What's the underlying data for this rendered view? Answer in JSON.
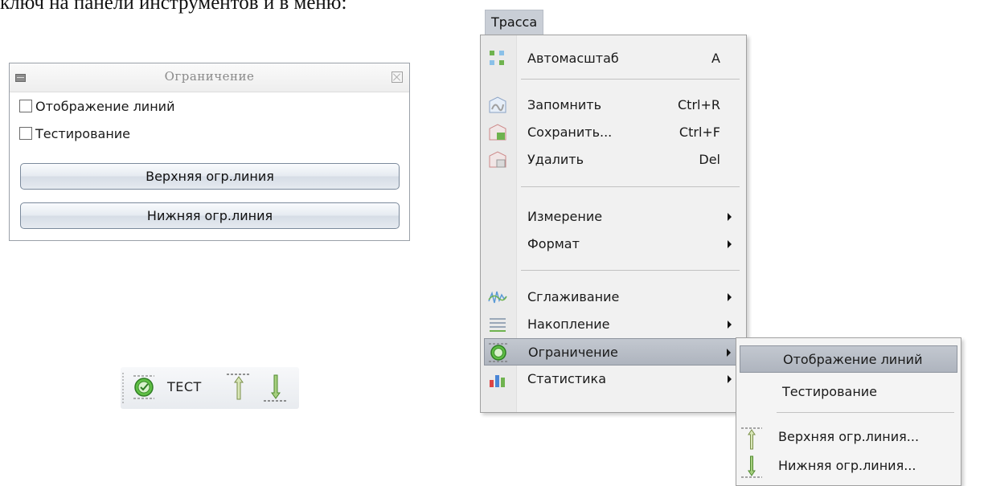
{
  "document_text": "ключ на панели инструментов и в меню:",
  "panel": {
    "title": "Ограничение",
    "checkboxes": [
      {
        "label": "Отображение линий",
        "checked": false
      },
      {
        "label": "Тестирование",
        "checked": false
      }
    ],
    "buttons": [
      "Верхняя огр.линия",
      "Нижняя огр.линия"
    ]
  },
  "toolbar": {
    "test_label": "ТЕСТ",
    "icons": [
      "limit-test-icon",
      "upper-limit-icon",
      "lower-limit-icon"
    ]
  },
  "menubar": {
    "title": "Трасса"
  },
  "menu": {
    "items": [
      {
        "label": "Автомасштаб",
        "shortcut": "A",
        "icon": "autoscale-icon"
      },
      {
        "label": "Запомнить",
        "shortcut": "Ctrl+R",
        "icon": "remember-trace-icon"
      },
      {
        "label": "Сохранить...",
        "shortcut": "Ctrl+F",
        "icon": "save-trace-icon"
      },
      {
        "label": "Удалить",
        "shortcut": "Del",
        "icon": "delete-trace-icon"
      },
      {
        "label": "Измерение",
        "submenu": true
      },
      {
        "label": "Формат",
        "submenu": true
      },
      {
        "label": "Сглаживание",
        "submenu": true,
        "icon": "smoothing-icon"
      },
      {
        "label": "Накопление",
        "submenu": true,
        "icon": "accumulation-icon"
      },
      {
        "label": "Ограничение",
        "submenu": true,
        "icon": "limit-icon",
        "highlighted": true
      },
      {
        "label": "Статистика",
        "submenu": true,
        "icon": "statistics-icon"
      }
    ]
  },
  "submenu": {
    "items": [
      {
        "label": "Отображение линий",
        "highlighted": true
      },
      {
        "label": "Тестирование"
      },
      {
        "label": "Верхняя огр.линия...",
        "icon": "upper-limit-icon"
      },
      {
        "label": "Нижняя огр.линия...",
        "icon": "lower-limit-icon"
      }
    ]
  },
  "colors": {
    "menu_highlight": "#b9bfc8",
    "menu_background": "#f1f1f1",
    "limit_icon_green": "#4caf3a"
  }
}
